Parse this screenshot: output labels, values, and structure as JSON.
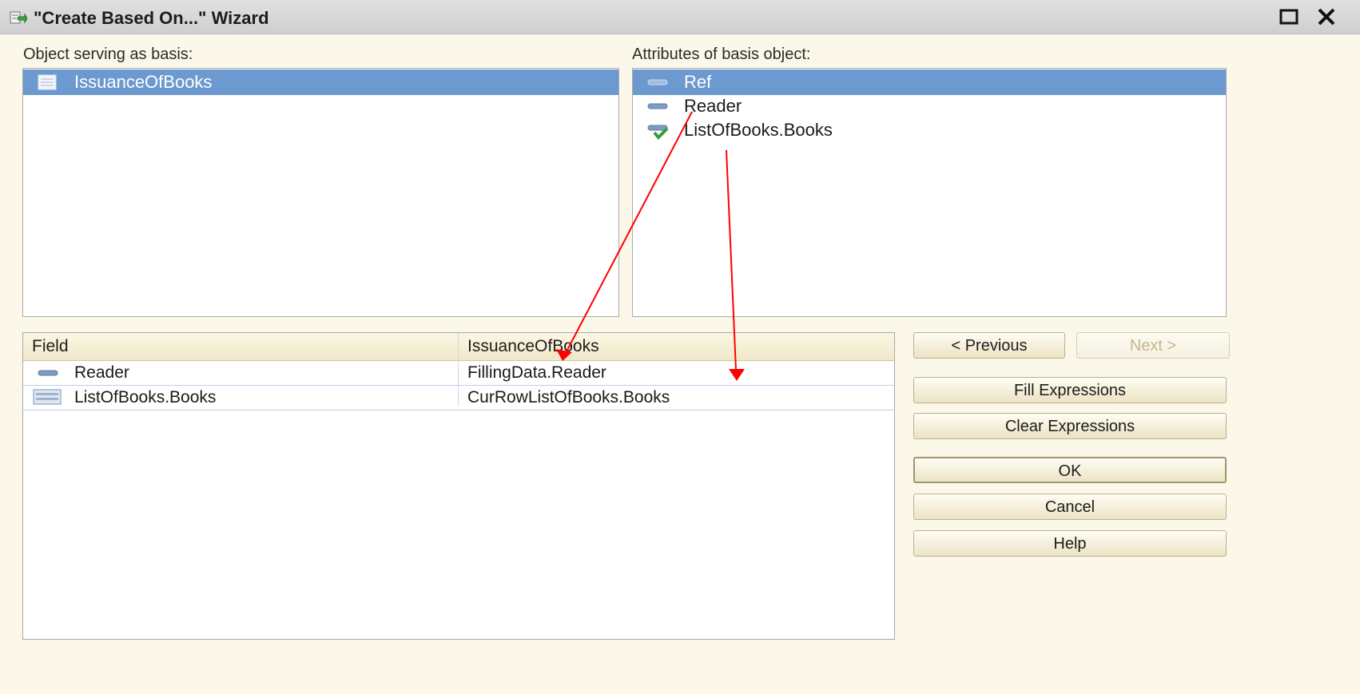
{
  "window": {
    "title": "\"Create Based On...\" Wizard"
  },
  "basis_object": {
    "label": "Object serving as basis:",
    "items": [
      {
        "label": "IssuanceOfBooks",
        "selected": true
      }
    ]
  },
  "attributes": {
    "label": "Attributes of basis object:",
    "items": [
      {
        "label": "Ref",
        "selected": true,
        "icon": "attribute-icon"
      },
      {
        "label": "Reader",
        "selected": false,
        "icon": "attribute-icon"
      },
      {
        "label": "ListOfBooks.Books",
        "selected": false,
        "icon": "tabular-attribute-icon"
      }
    ]
  },
  "fields_table": {
    "columns": [
      "Field",
      "IssuanceOfBooks"
    ],
    "rows": [
      {
        "field": "Reader",
        "expression": "FillingData.Reader",
        "icon": "attribute-icon"
      },
      {
        "field": "ListOfBooks.Books",
        "expression": "CurRowListOfBooks.Books",
        "icon": "table-icon"
      }
    ]
  },
  "buttons": {
    "previous": "< Previous",
    "next": "Next >",
    "fill_expressions": "Fill Expressions",
    "clear_expressions": "Clear Expressions",
    "ok": "OK",
    "cancel": "Cancel",
    "help": "Help"
  },
  "colors": {
    "selection": "#6c99cf",
    "annotation_arrow": "#ff0000",
    "background": "#fbf8ea"
  }
}
